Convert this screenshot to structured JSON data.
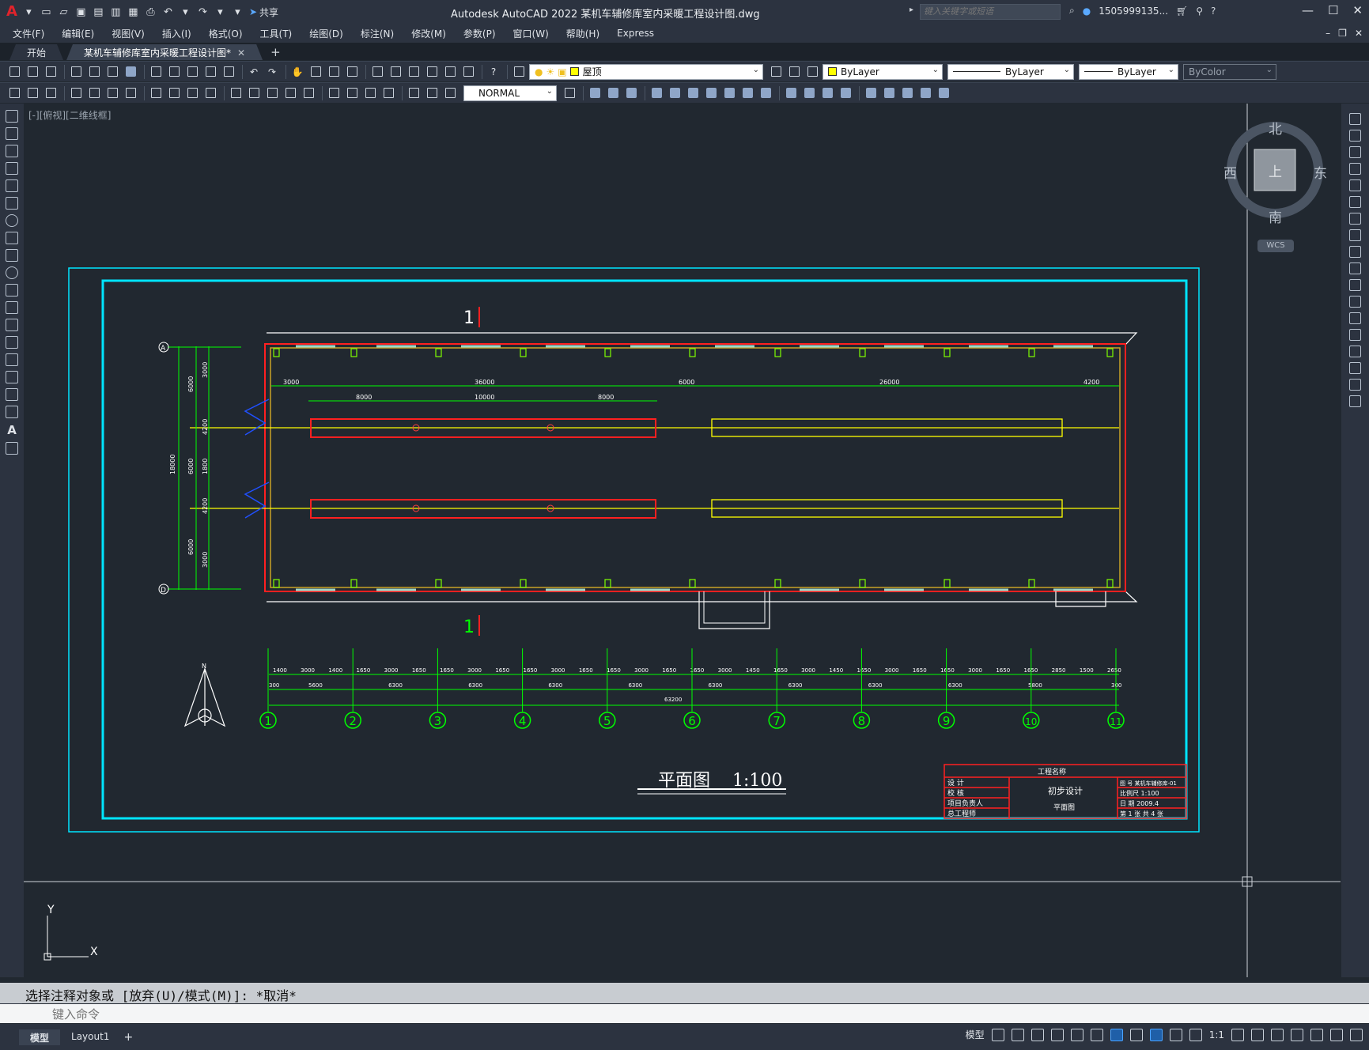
{
  "app": {
    "title": "Autodesk AutoCAD 2022    某机车辅修库室内采暖工程设计图.dwg",
    "share_label": "共享",
    "search_placeholder": "键入关键字或短语",
    "user": "1505999135...",
    "logo": "A"
  },
  "menu": [
    "文件(F)",
    "编辑(E)",
    "视图(V)",
    "插入(I)",
    "格式(O)",
    "工具(T)",
    "绘图(D)",
    "标注(N)",
    "修改(M)",
    "参数(P)",
    "窗口(W)",
    "帮助(H)",
    "Express"
  ],
  "tabs": {
    "start": "开始",
    "drawing": "某机车辅修库室内采暖工程设计图*"
  },
  "toolbar": {
    "layer": "屋顶",
    "color": "ByLayer",
    "linetype": "ByLayer",
    "lineweight": "ByLayer",
    "plotstyle": "ByColor",
    "dimstyle": "NORMAL"
  },
  "viewport": {
    "label": "[-][俯视][二维线框]"
  },
  "viewcube": {
    "north": "北",
    "south": "南",
    "east": "东",
    "west": "西",
    "top": "上",
    "wcs": "WCS"
  },
  "drawing": {
    "section_mark_top": "1",
    "section_mark_bottom": "1",
    "plan_title": "平面图",
    "plan_scale": "1:100",
    "axis_a": "A",
    "axis_d": "D",
    "axis_numbers": [
      "1",
      "2",
      "3",
      "4",
      "5",
      "6",
      "7",
      "8",
      "9",
      "10",
      "11"
    ],
    "north_label": "N",
    "top_dims": [
      "3000",
      "36000",
      "6000",
      "26000",
      "4200"
    ],
    "top_sub_dims": [
      "8000",
      "10000",
      "8000"
    ],
    "left_dims_outer": [
      "6000",
      "6000",
      "6000"
    ],
    "left_dims_inner": [
      "3000",
      "4200",
      "1800",
      "4200",
      "3000"
    ],
    "left_total": "18000",
    "bottom_row1": [
      "1400",
      "3000",
      "1400",
      "1650",
      "3000",
      "1650",
      "1650",
      "3000",
      "1650",
      "1650",
      "3000",
      "1650",
      "1650",
      "3000",
      "1650",
      "1650",
      "3000",
      "1450",
      "1650",
      "3000",
      "1450",
      "1650",
      "3000",
      "1650",
      "1650",
      "3000",
      "1650",
      "1650",
      "2850",
      "1500",
      "2650"
    ],
    "bottom_row2": [
      "300",
      "5600",
      "6300",
      "6300",
      "6300",
      "6300",
      "6300",
      "6300",
      "6300",
      "6300",
      "5800",
      "300"
    ],
    "bottom_total": "63200"
  },
  "titleblock": {
    "project_label": "工程名称",
    "row1_label": "设   计",
    "row2_label": "校   核",
    "row3_label": "项目负责人",
    "row4_label": "总工程师",
    "stage": "初步设计",
    "sheet_name": "平面图",
    "drawing_no": "图   号  某机车辅修库-01",
    "scale": "比例尺 1:100",
    "date": "日   期 2009.4",
    "sheet_count": "第 1 张  共 4 张"
  },
  "ucs": {
    "x": "X",
    "y": "Y"
  },
  "command": {
    "history": "选择注释对象或 [放弃(U)/模式(M)]: *取消*",
    "placeholder": "键入命令"
  },
  "layouts": [
    "模型",
    "Layout1"
  ],
  "status": {
    "model": "模型",
    "scale": "1:1"
  }
}
